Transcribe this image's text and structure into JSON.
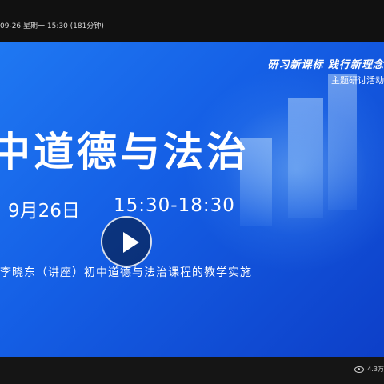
{
  "header": {
    "datetime": "09-26 星期一 15:30 (181分钟)"
  },
  "slide": {
    "slogan": "研习新课标 践行新理念",
    "activity": "主题研讨活动",
    "title": "中道德与法治",
    "date": "9月26日",
    "time": "15:30-18:30",
    "lecture": "李晓东（讲座）初中道德与法治课程的教学实施"
  },
  "footer": {
    "views": "4.3万"
  },
  "icons": {
    "play": "play-icon",
    "views": "eye-icon"
  },
  "colors": {
    "slide_blue": "#1a6cf0",
    "bar_dark": "#111111"
  }
}
